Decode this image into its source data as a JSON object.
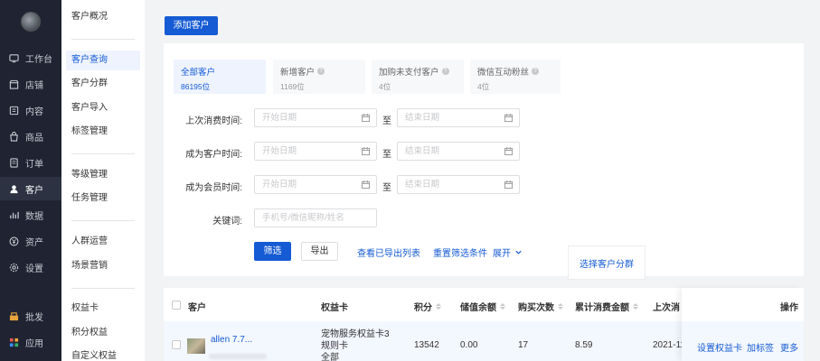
{
  "nav_primary": [
    {
      "label": "工作台",
      "icon": "dashboard-icon"
    },
    {
      "label": "店铺",
      "icon": "store-icon"
    },
    {
      "label": "内容",
      "icon": "content-icon"
    },
    {
      "label": "商品",
      "icon": "goods-icon"
    },
    {
      "label": "订单",
      "icon": "order-icon"
    },
    {
      "label": "客户",
      "icon": "customer-icon"
    },
    {
      "label": "数据",
      "icon": "data-icon"
    },
    {
      "label": "资产",
      "icon": "asset-icon"
    },
    {
      "label": "设置",
      "icon": "settings-icon"
    },
    {
      "label": "批发",
      "icon": "wholesale-icon"
    },
    {
      "label": "应用",
      "icon": "apps-icon"
    }
  ],
  "nav_secondary": [
    "客户概况",
    "客户查询",
    "客户分群",
    "客户导入",
    "标签管理",
    "等级管理",
    "任务管理",
    "人群运营",
    "场景营销",
    "权益卡",
    "积分权益",
    "自定义权益"
  ],
  "add_button": "添加客户",
  "segments": [
    {
      "title": "全部客户",
      "count": "86195位"
    },
    {
      "title": "新增客户",
      "count": "1169位"
    },
    {
      "title": "加购未支付客户",
      "count": "4位"
    },
    {
      "title": "微信互动粉丝",
      "count": "4位"
    }
  ],
  "select_group": "选择客户分群",
  "filters": {
    "last_purchase": "上次消费时间:",
    "became_customer": "成为客户时间:",
    "became_member": "成为会员时间:",
    "keyword": "关键词:",
    "start_placeholder": "开始日期",
    "end_placeholder": "结束日期",
    "to": "至",
    "keyword_placeholder": "手机号/微信昵称/姓名"
  },
  "actions": {
    "filter": "筛选",
    "export": "导出",
    "view_exports": "查看已导出列表",
    "reset": "重置筛选条件",
    "expand": "展开"
  },
  "table": {
    "headers": {
      "customer": "客户",
      "card": "权益卡",
      "points": "积分",
      "balance": "储值余额",
      "purchases": "购买次数",
      "spent": "累计消费金额",
      "last": "上次消",
      "ops": "操作"
    },
    "row": {
      "name": "allen 7.7...",
      "card_line1": "宠物服务权益卡3",
      "card_line2": "规则卡",
      "card_line3": "全部",
      "points": "13542",
      "balance": "0.00",
      "purchases": "17",
      "spent": "8.59",
      "last": "2021-11",
      "op_set_card": "设置权益卡",
      "op_tag": "加标签",
      "op_more": "更多"
    }
  },
  "colors": {
    "primary": "#155bd4",
    "sidebar": "#1f2332"
  }
}
